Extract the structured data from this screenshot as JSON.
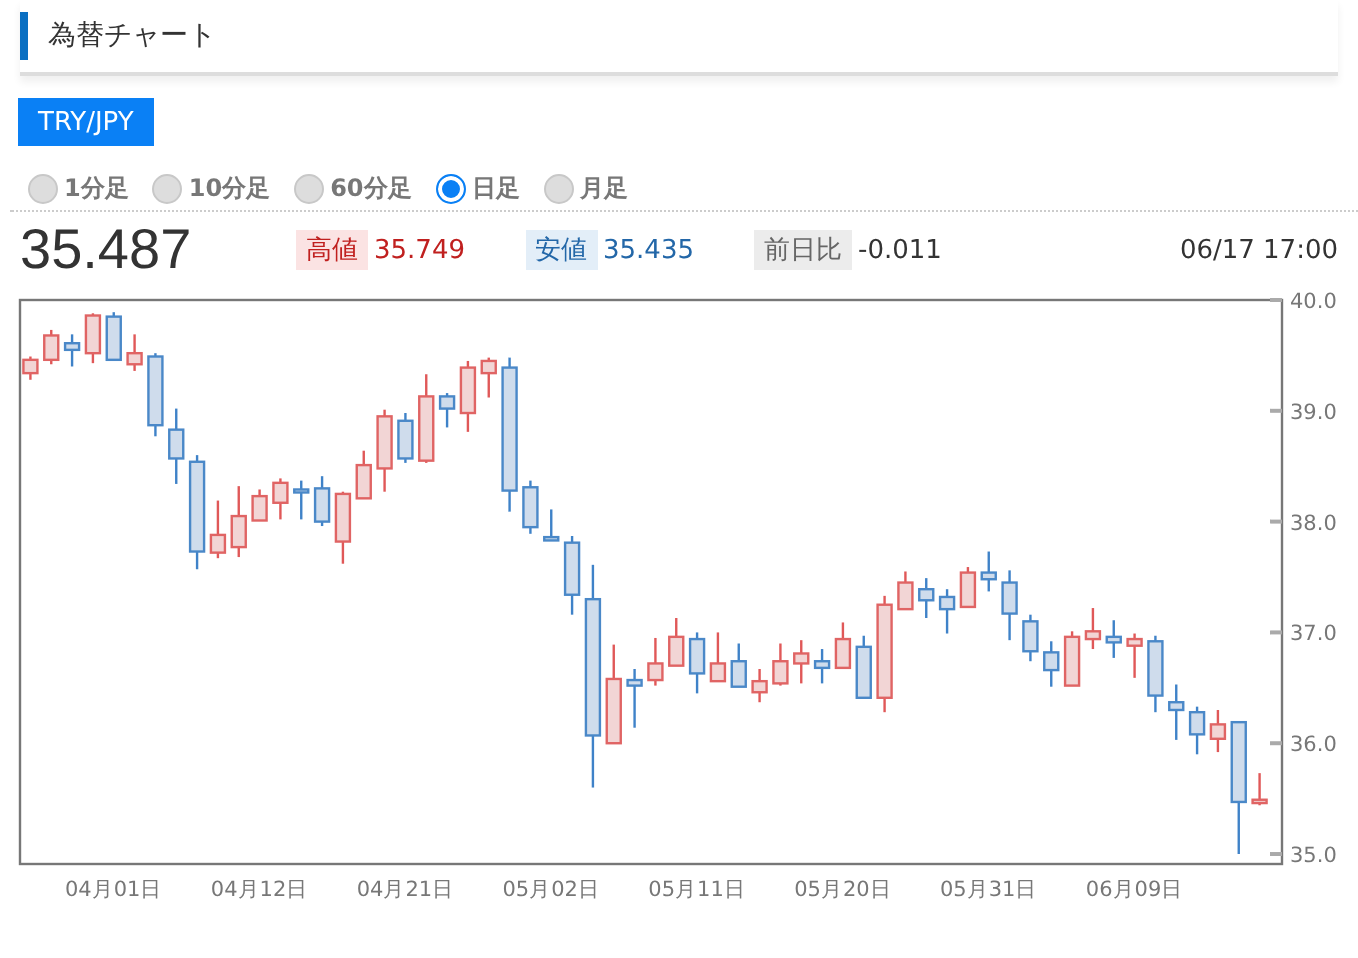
{
  "header": {
    "title": "為替チャート"
  },
  "pair_button": {
    "label": "TRY/JPY"
  },
  "periods": [
    {
      "label": "1分足",
      "selected": false
    },
    {
      "label": "10分足",
      "selected": false
    },
    {
      "label": "60分足",
      "selected": false
    },
    {
      "label": "日足",
      "selected": true
    },
    {
      "label": "月足",
      "selected": false
    }
  ],
  "quote": {
    "price": "35.487",
    "stats": [
      {
        "kind": "high",
        "label": "高値",
        "value": "35.749"
      },
      {
        "kind": "low",
        "label": "安値",
        "value": "35.435"
      },
      {
        "kind": "change",
        "label": "前日比",
        "value": "-0.011"
      }
    ],
    "timestamp": "06/17 17:00"
  },
  "chart": {
    "chart_data": {
      "type": "candlestick",
      "ylim": [
        34.91,
        40
      ],
      "yticks": [
        {
          "value": 35,
          "label": "35.0"
        },
        {
          "value": 36,
          "label": "36.0"
        },
        {
          "value": 37,
          "label": "37.0"
        },
        {
          "value": 38,
          "label": "38.0"
        },
        {
          "value": 39,
          "label": "39.0"
        },
        {
          "value": 40,
          "label": "40.0"
        }
      ],
      "categories": [
        null,
        null,
        null,
        null,
        "04月01日",
        null,
        null,
        null,
        null,
        null,
        null,
        "04月12日",
        null,
        null,
        null,
        null,
        null,
        null,
        "04月21日",
        null,
        null,
        null,
        null,
        null,
        null,
        "05月02日",
        null,
        null,
        null,
        null,
        null,
        null,
        "05月11日",
        null,
        null,
        null,
        null,
        null,
        null,
        "05月20日",
        null,
        null,
        null,
        null,
        null,
        null,
        "05月31日",
        null,
        null,
        null,
        null,
        null,
        null,
        "06月09日",
        null,
        null,
        null,
        null,
        null,
        null
      ],
      "ohlc": [
        [
          39.34,
          39.49,
          39.28,
          39.46
        ],
        [
          39.46,
          39.73,
          39.42,
          39.68
        ],
        [
          39.61,
          39.69,
          39.4,
          39.55
        ],
        [
          39.52,
          39.88,
          39.43,
          39.86
        ],
        [
          39.85,
          39.89,
          39.45,
          39.46
        ],
        [
          39.42,
          39.69,
          39.36,
          39.52
        ],
        [
          39.49,
          39.52,
          38.77,
          38.87
        ],
        [
          38.83,
          39.02,
          38.34,
          38.57
        ],
        [
          38.54,
          38.6,
          37.57,
          37.73
        ],
        [
          37.72,
          38.19,
          37.67,
          37.88
        ],
        [
          37.77,
          38.32,
          37.68,
          38.05
        ],
        [
          38.01,
          38.29,
          38.01,
          38.23
        ],
        [
          38.17,
          38.39,
          38.02,
          38.35
        ],
        [
          38.29,
          38.37,
          38.02,
          38.28
        ],
        [
          38.3,
          38.41,
          37.96,
          38.0
        ],
        [
          37.82,
          38.27,
          37.62,
          38.25
        ],
        [
          38.21,
          38.64,
          38.21,
          38.51
        ],
        [
          38.48,
          39.01,
          38.27,
          38.95
        ],
        [
          38.91,
          38.98,
          38.53,
          38.57
        ],
        [
          38.55,
          39.33,
          38.53,
          39.13
        ],
        [
          39.13,
          39.16,
          38.85,
          39.02
        ],
        [
          38.98,
          39.45,
          38.81,
          39.39
        ],
        [
          39.34,
          39.48,
          39.12,
          39.45
        ],
        [
          39.39,
          39.48,
          38.09,
          38.28
        ],
        [
          38.31,
          38.37,
          37.89,
          37.95
        ],
        [
          37.86,
          38.11,
          37.83,
          37.83
        ],
        [
          37.81,
          37.87,
          37.16,
          37.34
        ],
        [
          37.3,
          37.61,
          35.6,
          36.07
        ],
        [
          36.0,
          36.89,
          36.0,
          36.58
        ],
        [
          36.57,
          36.67,
          36.14,
          36.52
        ],
        [
          36.57,
          36.95,
          36.52,
          36.72
        ],
        [
          36.7,
          37.13,
          36.7,
          36.96
        ],
        [
          36.94,
          37.0,
          36.45,
          36.63
        ],
        [
          36.56,
          37.0,
          36.56,
          36.72
        ],
        [
          36.74,
          36.9,
          36.51,
          36.51
        ],
        [
          36.46,
          36.67,
          36.37,
          36.56
        ],
        [
          36.54,
          36.9,
          36.52,
          36.74
        ],
        [
          36.72,
          36.93,
          36.54,
          36.81
        ],
        [
          36.74,
          36.85,
          36.54,
          36.68
        ],
        [
          36.68,
          37.09,
          36.68,
          36.94
        ],
        [
          36.87,
          36.97,
          36.41,
          36.41
        ],
        [
          36.41,
          37.33,
          36.28,
          37.25
        ],
        [
          37.21,
          37.55,
          37.21,
          37.45
        ],
        [
          37.39,
          37.49,
          37.13,
          37.29
        ],
        [
          37.32,
          37.39,
          36.99,
          37.21
        ],
        [
          37.23,
          37.59,
          37.23,
          37.54
        ],
        [
          37.54,
          37.73,
          37.37,
          37.48
        ],
        [
          37.45,
          37.56,
          36.93,
          37.17
        ],
        [
          37.1,
          37.16,
          36.74,
          36.83
        ],
        [
          36.82,
          36.92,
          36.51,
          36.66
        ],
        [
          36.52,
          37.01,
          36.52,
          36.96
        ],
        [
          36.94,
          37.22,
          36.85,
          37.01
        ],
        [
          36.96,
          37.11,
          36.77,
          36.91
        ],
        [
          36.88,
          36.99,
          36.59,
          36.94
        ],
        [
          36.92,
          36.97,
          36.28,
          36.43
        ],
        [
          36.37,
          36.53,
          36.03,
          36.3
        ],
        [
          36.28,
          36.33,
          35.9,
          36.08
        ],
        [
          36.04,
          36.3,
          35.92,
          36.17
        ],
        [
          36.19,
          36.19,
          35.0,
          35.47
        ],
        [
          35.46,
          35.73,
          35.44,
          35.49
        ]
      ]
    }
  }
}
